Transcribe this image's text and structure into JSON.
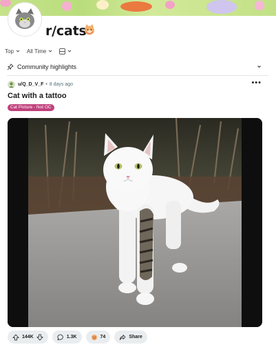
{
  "subreddit": {
    "name": "r/cats"
  },
  "sort": {
    "sort_label": "Top",
    "time_label": "All Time",
    "view_icon": "layout-icon"
  },
  "highlights": {
    "label": "Community highlights"
  },
  "post": {
    "author": "u/Q_D_V_F",
    "separator": "•",
    "age": "8 days ago",
    "more": "•••",
    "title": "Cat with a tattoo",
    "flair": "Cat Picture - Not OC",
    "score": "144K",
    "comments": "1.3K",
    "awards": "74",
    "share_label": "Share"
  },
  "colors": {
    "flair_bg": "#c0417c",
    "pill_bg": "#eaedef",
    "banner": "#c6e38a"
  }
}
